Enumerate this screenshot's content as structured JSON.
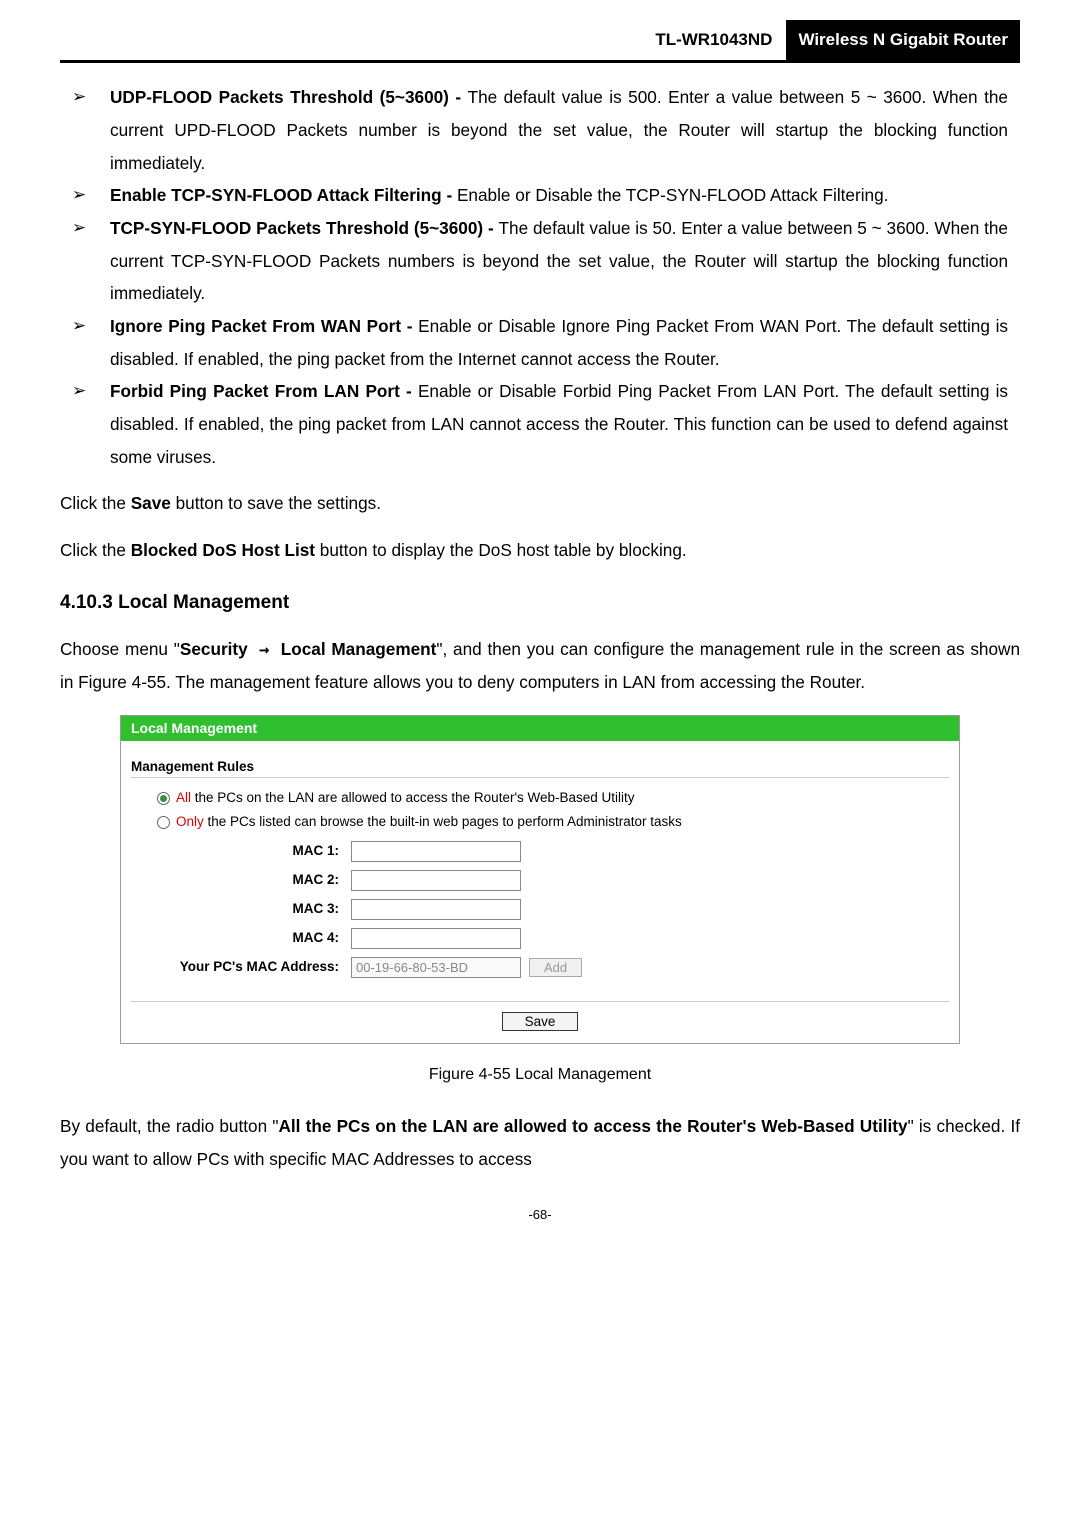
{
  "header": {
    "model": "TL-WR1043ND",
    "badge": "Wireless N Gigabit Router"
  },
  "bullets": [
    {
      "title": "UDP-FLOOD Packets Threshold (5~3600) - ",
      "body": "The default value is 500. Enter a value between 5 ~ 3600. When the current UPD-FLOOD Packets number is beyond the set value, the Router will startup the blocking function immediately."
    },
    {
      "title": "Enable TCP-SYN-FLOOD Attack Filtering - ",
      "body": "Enable or Disable the TCP-SYN-FLOOD Attack Filtering."
    },
    {
      "title": "TCP-SYN-FLOOD Packets Threshold (5~3600) - ",
      "body": "The default value is 50. Enter a value between 5 ~ 3600. When the current TCP-SYN-FLOOD Packets numbers is beyond the set value, the Router will startup the blocking function immediately."
    },
    {
      "title": "Ignore Ping Packet From WAN Port - ",
      "body": "Enable or Disable Ignore Ping Packet From WAN Port. The default setting is disabled. If enabled, the ping packet from the Internet cannot access the Router."
    },
    {
      "title": "Forbid Ping Packet From LAN Port - ",
      "body": "Enable or Disable Forbid Ping Packet From LAN Port. The default setting is disabled. If enabled, the ping packet from LAN cannot access the Router. This function can be used to defend against some viruses."
    }
  ],
  "save_line_pre": "Click the ",
  "save_line_bold": "Save",
  "save_line_post": " button to save the settings.",
  "blocked_line_pre": "Click the ",
  "blocked_line_bold": "Blocked DoS Host List",
  "blocked_line_post": " button to display the DoS host table by blocking.",
  "section_heading": "4.10.3  Local Management",
  "choose_line_pre": "Choose menu \"",
  "choose_line_bold1": "Security",
  "choose_line_mid": " → ",
  "choose_line_bold2": "Local Management",
  "choose_line_post": "\", and then you can configure the management rule in the screen as shown in Figure 4-55. The management feature allows you to deny computers in LAN from accessing the Router.",
  "figure": {
    "title": "Local Management",
    "rules_label": "Management Rules",
    "radio1_hl": "All",
    "radio1_rest": " the PCs on the LAN are allowed to access the Router's Web-Based Utility",
    "radio2_hl": "Only",
    "radio2_rest": " the PCs listed can browse the built-in web pages to perform Administrator tasks",
    "mac1": "MAC 1:",
    "mac2": "MAC 2:",
    "mac3": "MAC 3:",
    "mac4": "MAC 4:",
    "yourpc_label": "Your PC's MAC Address:",
    "yourpc_value": "00-19-66-80-53-BD",
    "add_label": "Add",
    "save_label": "Save"
  },
  "figure_caption": "Figure 4-55 Local Management",
  "ending_pre": "By default, the radio button \"",
  "ending_bold": "All the PCs on the LAN are allowed to access the Router's Web-Based Utility",
  "ending_post": "\" is checked. If you want to allow PCs with specific MAC Addresses to access",
  "page_number": "-68-"
}
